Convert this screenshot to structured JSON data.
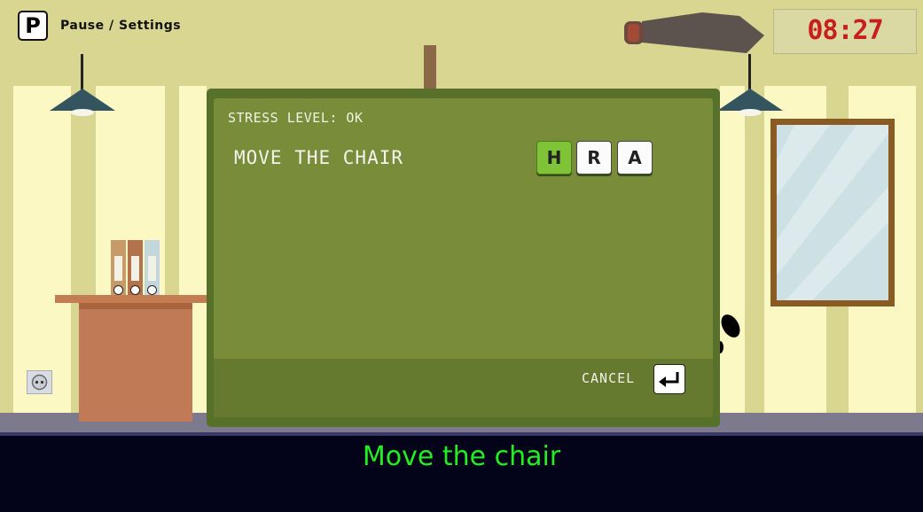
{
  "hud": {
    "pause_key": "P",
    "pause_label": "Pause / Settings",
    "timer": "08:27"
  },
  "dialog": {
    "stress_level": "STRESS LEVEL: OK",
    "action": "MOVE THE CHAIR",
    "keys": [
      {
        "label": "H",
        "active": true
      },
      {
        "label": "R",
        "active": false
      },
      {
        "label": "A",
        "active": false
      }
    ],
    "cancel_label": "CANCEL",
    "confirm_icon": "enter-icon"
  },
  "subtitle": "Move the chair",
  "colors": {
    "wall": "#d8d690",
    "dialog_bg": "#788c3a",
    "active_key": "#7fc337",
    "timer_text": "#c81e1e",
    "subtitle_text": "#22ee22"
  }
}
